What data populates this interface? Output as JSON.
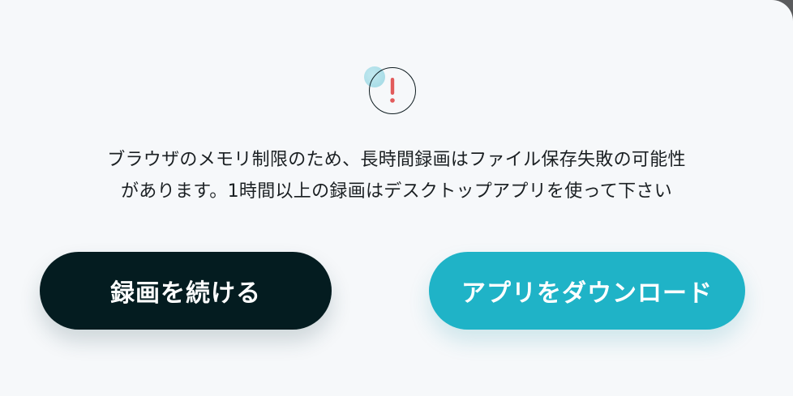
{
  "dialog": {
    "icon": "warning-exclamation-icon",
    "message_lines": [
      "ブラウザのメモリ制限のため、長時間録画はファイル保存失敗の可能性",
      "があります。1時間以上の録画はデスクトップアプリを使って下さい"
    ],
    "buttons": {
      "continue_label": "録画を続ける",
      "download_label": "アプリをダウンロード"
    }
  },
  "colors": {
    "background": "#f6f8fa",
    "continue_button": "#041c20",
    "download_button": "#1fb3c7",
    "exclamation": "#e25b5b"
  }
}
